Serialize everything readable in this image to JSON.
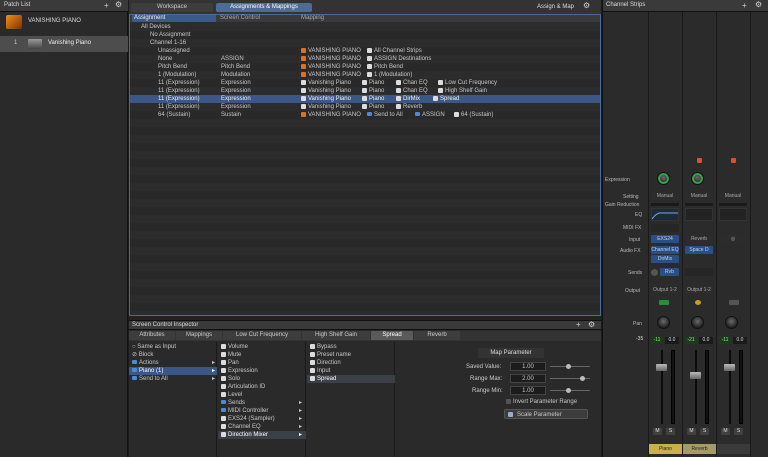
{
  "patch_list": {
    "title": "Patch List",
    "top_item": "VANISHING PIANO",
    "patch_index": "1",
    "patch_name": "Vanishing Piano"
  },
  "tabs": {
    "workspace": "Workspace",
    "assignments": "Assignments & Mappings",
    "assign_map": "Assign & Map"
  },
  "table": {
    "headers": [
      "Assignment",
      "Screen Control",
      "Mapping"
    ],
    "rows": [
      {
        "a": "All Devices",
        "s": "",
        "m": ""
      },
      {
        "a": "No Assignment",
        "s": "",
        "m": ""
      },
      {
        "a": "Channel 1-16",
        "s": "",
        "m": ""
      },
      {
        "a": "Unassigned",
        "s": "",
        "m1": "VANISHING PIANO",
        "m2": "All Channel Strips"
      },
      {
        "a": "None",
        "s": "ASSIGN",
        "m1": "VANISHING PIANO",
        "m2": "ASSIGN Destinations"
      },
      {
        "a": "Pitch Bend",
        "s": "Pitch Bend",
        "m1": "VANISHING PIANO",
        "m2": "Pitch Bend"
      },
      {
        "a": "1 (Modulation)",
        "s": "Modulation",
        "m1": "VANISHING PIANO",
        "m2": "1 (Modulation)"
      },
      {
        "a": "11 (Expression)",
        "s": "Expression",
        "m1": "Vanishing Piano",
        "m2": "Piano",
        "m3": "Chan EQ",
        "m4": "Low Cut Frequency"
      },
      {
        "a": "11 (Expression)",
        "s": "Expression",
        "m1": "Vanishing Piano",
        "m2": "Piano",
        "m3": "Chan EQ",
        "m4": "High Shelf Gain"
      },
      {
        "a": "11 (Expression)",
        "s": "Expression",
        "m1": "Vanishing Piano",
        "m2": "Piano",
        "m3": "DirMix",
        "m4": "Spread"
      },
      {
        "a": "11 (Expression)",
        "s": "Expression",
        "m1": "Vanishing Piano",
        "m2": "Piano",
        "m3": "Reverb",
        "m4": ""
      },
      {
        "a": "64 (Sustain)",
        "s": "Sustain",
        "m1": "VANISHING PIANO",
        "m2": "Send to All",
        "m3": "ASSIGN",
        "m4": "64 (Sustain)"
      }
    ]
  },
  "inspector": {
    "title": "Screen Control Inspector",
    "tabs": [
      "Attributes",
      "Mappings",
      "Low Cut Frequency",
      "High Shelf Gain",
      "Spread",
      "Reverb"
    ],
    "col1": [
      "Same as Input",
      "Block",
      "Actions",
      "Piano (1)",
      "Send to All"
    ],
    "col2": [
      "Volume",
      "Mute",
      "Pan",
      "Expression",
      "Solo",
      "Articulation ID",
      "Level",
      "Sends",
      "MIDI Controller",
      "EXS24 (Sampler)",
      "Channel EQ",
      "Direction Mixer"
    ],
    "col3": [
      "Bypass",
      "Preset name",
      "Direction",
      "Input",
      "Spread"
    ],
    "map_param": {
      "title": "Map Parameter",
      "saved_label": "Saved Value:",
      "saved_value": "1.00",
      "max_label": "Range Max:",
      "max_value": "2.00",
      "min_label": "Range Min:",
      "min_value": "1.00",
      "invert": "Invert Parameter Range",
      "scale": "Scale Parameter"
    }
  },
  "channel_strips": {
    "title": "Channel Strips",
    "labels": [
      "Expression",
      "Setting",
      "Gain Reduction",
      "EQ",
      "MIDI FX",
      "Input",
      "Audio FX",
      "Sends",
      "Output",
      "Pan"
    ],
    "setting": [
      "Manual",
      "Manual",
      "Manual"
    ],
    "input": [
      "EXS24",
      "Reverb",
      ""
    ],
    "audio_fx": [
      "Channel EQ",
      "DirMix",
      "Space D"
    ],
    "sends_value": "Rvb",
    "output": [
      "Output 1-2",
      "Output 1-2",
      ""
    ],
    "pan_value": "-35",
    "vol_a": [
      "-11",
      "0.0"
    ],
    "vol_b": [
      "-21",
      "0.0"
    ],
    "vol_c": [
      "-11",
      "0.0"
    ],
    "names": [
      "Piano",
      "Reverb",
      ""
    ],
    "ms": [
      "M",
      "S"
    ]
  },
  "icons": [
    "plus-icon",
    "gear-icon",
    "piano-icon",
    "search-icon",
    "chevron-down-icon"
  ]
}
